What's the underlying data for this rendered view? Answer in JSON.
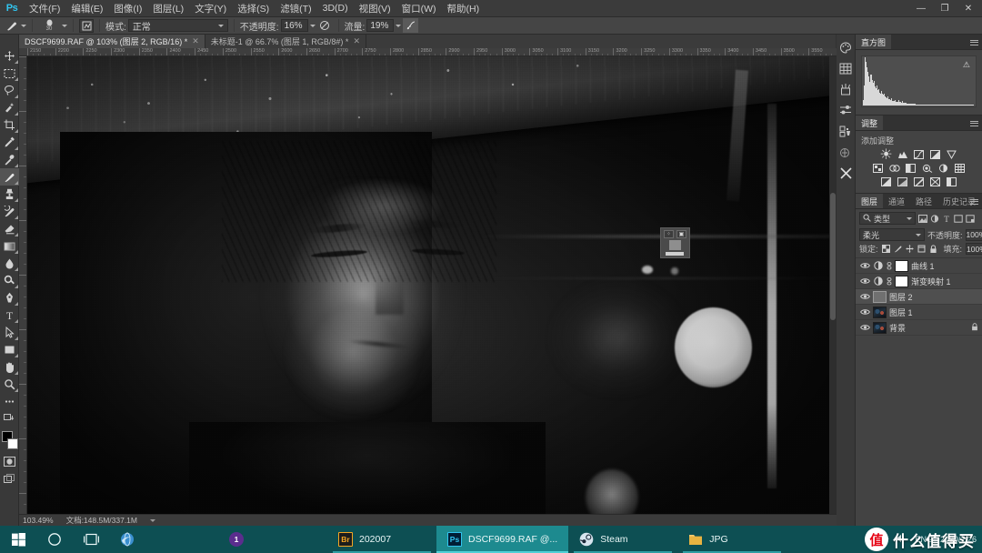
{
  "app": {
    "name": "Photoshop",
    "logo_text": "Ps",
    "accent_color": "#31c5f0"
  },
  "menubar": {
    "items": [
      {
        "label": "文件(F)"
      },
      {
        "label": "编辑(E)"
      },
      {
        "label": "图像(I)"
      },
      {
        "label": "图层(L)"
      },
      {
        "label": "文字(Y)"
      },
      {
        "label": "选择(S)"
      },
      {
        "label": "滤镜(T)"
      },
      {
        "label": "3D(D)"
      },
      {
        "label": "视图(V)"
      },
      {
        "label": "窗口(W)"
      },
      {
        "label": "帮助(H)"
      }
    ],
    "window_controls": {
      "minimize": "—",
      "restore": "❐",
      "close": "✕"
    }
  },
  "options_bar": {
    "tool_icon": "brush-icon",
    "brush_size": "30",
    "mode_label": "模式:",
    "mode_value": "正常",
    "opacity_label": "不透明度:",
    "opacity_value": "16%",
    "flow_label": "流量:",
    "flow_value": "19%",
    "airbrush_icon": "airbrush-icon",
    "smoothing_icon": "smoothing-icon"
  },
  "document_tabs": [
    {
      "label": "DSCF9699.RAF @ 103% (图层 2, RGB/16) *",
      "close": "✕",
      "active": true
    },
    {
      "label": "未标题-1 @ 66.7% (图层 1, RGB/8#) *",
      "close": "✕",
      "active": false
    }
  ],
  "toolbar": {
    "tools": [
      {
        "name": "move-tool",
        "active": false
      },
      {
        "name": "rectangular-marquee-tool",
        "active": false
      },
      {
        "name": "lasso-tool",
        "active": false
      },
      {
        "name": "quick-selection-tool",
        "active": false
      },
      {
        "name": "crop-tool",
        "active": false
      },
      {
        "name": "eyedropper-tool",
        "active": false
      },
      {
        "name": "spot-healing-brush-tool",
        "active": false
      },
      {
        "name": "brush-tool",
        "active": true
      },
      {
        "name": "clone-stamp-tool",
        "active": false
      },
      {
        "name": "history-brush-tool",
        "active": false
      },
      {
        "name": "eraser-tool",
        "active": false
      },
      {
        "name": "gradient-tool",
        "active": false
      },
      {
        "name": "blur-tool",
        "active": false
      },
      {
        "name": "dodge-tool",
        "active": false
      },
      {
        "name": "pen-tool",
        "active": false
      },
      {
        "name": "type-tool",
        "active": false
      },
      {
        "name": "path-selection-tool",
        "active": false
      },
      {
        "name": "rectangle-tool",
        "active": false
      },
      {
        "name": "hand-tool",
        "active": false
      },
      {
        "name": "zoom-tool",
        "active": false
      },
      {
        "name": "edit-toolbar-tool",
        "active": false
      }
    ],
    "foreground_color": "#000000",
    "background_color": "#ffffff"
  },
  "canvas": {
    "ruler_unit": "px",
    "ruler_start": 2150,
    "ruler_step": 50,
    "ruler_end": 3600,
    "widget": {
      "name": "on-canvas-options-widget",
      "button_a": "⁘",
      "button_b": "▣"
    }
  },
  "status_bar": {
    "zoom": "103.49%",
    "doc_label": "文档:148.5M/337.1M"
  },
  "right_dock_icons": [
    {
      "name": "color-panel-icon"
    },
    {
      "name": "swatches-grid-icon"
    },
    {
      "name": "brush-presets-icon"
    },
    {
      "name": "brush-settings-icon"
    },
    {
      "name": "clone-source-icon"
    },
    {
      "name": "materials-icon"
    },
    {
      "name": "close-dock-icon"
    }
  ],
  "histogram_panel": {
    "tab_label": "直方图",
    "warning_icon": "warning-triangle-icon",
    "menu_icon": "panel-menu-icon"
  },
  "adjustments_panel": {
    "tab_label": "调整",
    "add_label": "添加调整",
    "menu_icon": "panel-menu-icon",
    "rows": [
      [
        "brightness-contrast-icon",
        "levels-icon",
        "curves-icon",
        "exposure-icon",
        "vibrance-icon"
      ],
      [
        "hue-saturation-icon",
        "color-balance-icon",
        "black-white-icon",
        "photo-filter-icon",
        "channel-mixer-icon",
        "color-lookup-icon"
      ],
      [
        "invert-icon",
        "posterize-icon",
        "threshold-icon",
        "gradient-map-icon",
        "selective-color-icon"
      ]
    ]
  },
  "layers_panel": {
    "tabs": [
      {
        "label": "图层",
        "active": true
      },
      {
        "label": "通道",
        "active": false
      },
      {
        "label": "路径",
        "active": false
      },
      {
        "label": "历史记录",
        "active": false
      }
    ],
    "menu_icon": "panel-menu-icon",
    "filter": {
      "kind_icon": "search-icon",
      "kind_label": "类型",
      "filter_icons": [
        "pixel-filter-icon",
        "adjustment-filter-icon",
        "type-filter-icon",
        "shape-filter-icon",
        "smart-object-filter-icon"
      ],
      "toggle_icon": "filter-toggle-icon"
    },
    "blend_mode": "柔光",
    "opacity_label": "不透明度:",
    "opacity_value": "100%",
    "lock_label": "锁定:",
    "lock_icons": [
      "lock-transparent-icon",
      "lock-image-icon",
      "lock-position-icon",
      "lock-artboard-icon",
      "lock-all-icon"
    ],
    "fill_label": "填充:",
    "fill_value": "100%",
    "layers": [
      {
        "name": "曲线 1",
        "visible": true,
        "thumb": "adjustment",
        "mask": true,
        "selected": false,
        "locked": false
      },
      {
        "name": "渐变映射 1",
        "visible": true,
        "thumb": "adjustment",
        "mask": true,
        "selected": false,
        "locked": false
      },
      {
        "name": "图层 2",
        "visible": true,
        "thumb": "grey",
        "mask": false,
        "selected": true,
        "locked": false
      },
      {
        "name": "图层 1",
        "visible": true,
        "thumb": "image",
        "mask": false,
        "selected": false,
        "locked": false
      },
      {
        "name": "背景",
        "visible": true,
        "thumb": "image",
        "mask": false,
        "selected": false,
        "locked": true
      }
    ]
  },
  "taskbar": {
    "start_icon": "windows-start-icon",
    "search_icon": "search-circle-icon",
    "taskview_icon": "task-view-icon",
    "apps": [
      {
        "label": "",
        "icon_text": "",
        "icon_name": "edge-browser-icon",
        "icon_bg": "#2d7fbe",
        "state": "pinned"
      },
      {
        "label": "",
        "icon_text": "1",
        "icon_name": "app-one-icon",
        "icon_bg": "#5b2d8e",
        "state": "pinned"
      },
      {
        "label": "202007",
        "icon_text": "Br",
        "icon_name": "bridge-icon",
        "icon_bg": "#1c1c1c",
        "state": "open"
      },
      {
        "label": "DSCF9699.RAF @...",
        "icon_text": "Ps",
        "icon_name": "photoshop-icon",
        "icon_bg": "#001e36",
        "state": "active"
      },
      {
        "label": "Steam",
        "icon_text": "",
        "icon_name": "steam-icon",
        "icon_bg": "#1b2838",
        "state": "open"
      },
      {
        "label": "JPG",
        "icon_text": "",
        "icon_name": "folder-icon",
        "icon_bg": "#e8b341",
        "state": "open"
      }
    ],
    "tray": {
      "battery_icon": "battery-icon",
      "chevron": "^",
      "volume_icon": "volume-icon",
      "ime_label": "ENG",
      "date": "2020/7/26"
    }
  },
  "watermark": {
    "badge": "值",
    "text": "什么值得买"
  }
}
